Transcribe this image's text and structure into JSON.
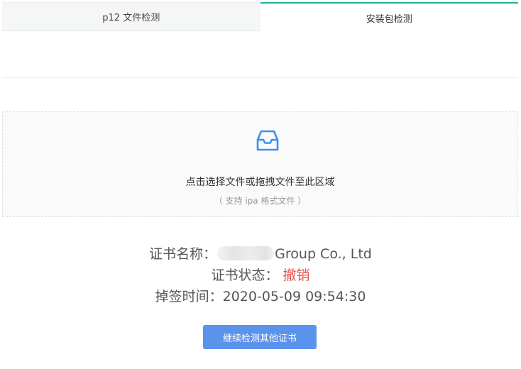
{
  "tabs": [
    {
      "label": "p12 文件检测",
      "active": false
    },
    {
      "label": "安装包检测",
      "active": true
    }
  ],
  "upload": {
    "icon": "inbox-icon",
    "title": "点击选择文件或拖拽文件至此区域",
    "hint": "（ 支持 ipa 格式文件 ）"
  },
  "result": {
    "name_label": "证书名称：",
    "name_value": "Group Co., Ltd",
    "status_label": "证书状态：",
    "status_value": "撤销",
    "time_label": "掉签时间：",
    "time_value": "2020-05-09 09:54:30"
  },
  "actions": {
    "continue_label": "继续检测其他证书"
  },
  "colors": {
    "accent": "#1fb19e",
    "icon": "#3d8ef0",
    "revoked": "#e8524a",
    "button": "#5b93ec"
  }
}
